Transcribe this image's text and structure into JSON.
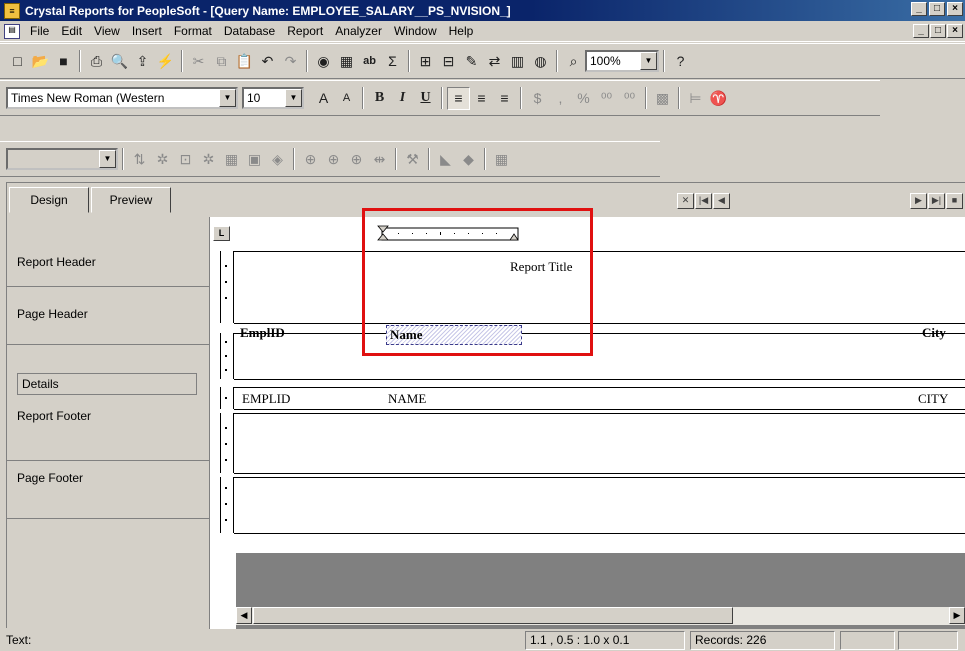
{
  "window": {
    "title": "Crystal Reports for PeopleSoft - [Query Name:  EMPLOYEE_SALARY__PS_NVISION_]",
    "controls": [
      "_",
      "□",
      "×"
    ]
  },
  "menu": [
    "File",
    "Edit",
    "View",
    "Insert",
    "Format",
    "Database",
    "Report",
    "Analyzer",
    "Window",
    "Help"
  ],
  "toolbar1": {
    "zoom_value": "100%"
  },
  "toolbar2": {
    "font_name": "Times New Roman (Western",
    "font_size": "10",
    "bold": "B",
    "italic": "I",
    "underline": "U",
    "currency": "$",
    "comma": ",",
    "percent": "%"
  },
  "tabs": [
    "Design",
    "Preview"
  ],
  "ruler_label": "L",
  "sections": [
    "Report Header",
    "Page Header",
    "Details",
    "Report Footer",
    "Page Footer"
  ],
  "fields": {
    "report_title": "Report Title",
    "header_emplid": "EmplID",
    "header_name": "Name",
    "header_city": "City",
    "detail_emplid": "EMPLID",
    "detail_name": "NAME",
    "detail_city": "CITY"
  },
  "status": {
    "left": "Text:",
    "position": "1.1 , 0.5 : 1.0 x 0.1",
    "records": "Records:  226"
  }
}
